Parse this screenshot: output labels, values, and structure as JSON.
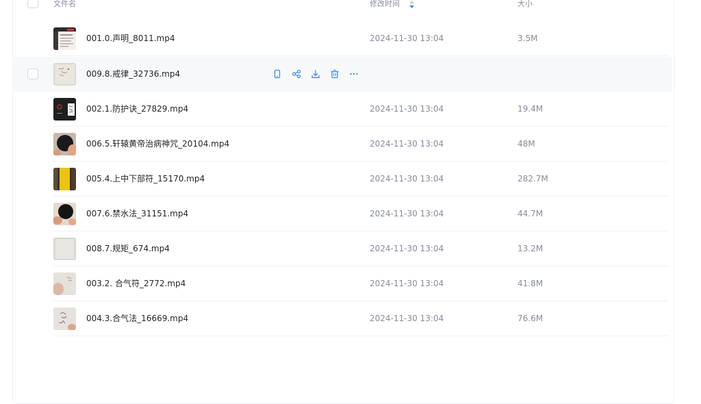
{
  "header": {
    "name_label": "文件名",
    "time_label": "修改时间",
    "size_label": "大小"
  },
  "accent": "#3a8ee6",
  "files": [
    {
      "name": "001.0.声明_8011.mp4",
      "time": "2024-11-30 13:04",
      "size": "3.5M",
      "thumb": "document-thumb"
    },
    {
      "name": "009.8.戒律_32736.mp4",
      "time": "",
      "size": "",
      "thumb": "paper-thumb",
      "hovered": true
    },
    {
      "name": "002.1.防护诀_27829.mp4",
      "time": "2024-11-30 13:04",
      "size": "19.4M",
      "thumb": "dark-slide-thumb"
    },
    {
      "name": "006.5.轩辕黄帝治病神咒_20104.mp4",
      "time": "2024-11-30 13:04",
      "size": "48M",
      "thumb": "hand-dark-thumb"
    },
    {
      "name": "005.4.上中下部符_15170.mp4",
      "time": "2024-11-30 13:04",
      "size": "282.7M",
      "thumb": "yellow-talisman-thumb"
    },
    {
      "name": "007.6.禁水法_31151.mp4",
      "time": "2024-11-30 13:04",
      "size": "44.7M",
      "thumb": "bowl-thumb"
    },
    {
      "name": "008.7.规矩_674.mp4",
      "time": "2024-11-30 13:04",
      "size": "13.2M",
      "thumb": "blank-paper-thumb"
    },
    {
      "name": "003.2. 合气符_2772.mp4",
      "time": "2024-11-30 13:04",
      "size": "41.8M",
      "thumb": "hand-paper-thumb"
    },
    {
      "name": "004.3.合气法_16669.mp4",
      "time": "2024-11-30 13:04",
      "size": "76.6M",
      "thumb": "sketch-paper-thumb"
    }
  ],
  "row_actions": [
    "phone-icon",
    "share-icon",
    "download-icon",
    "delete-icon",
    "more-icon"
  ]
}
